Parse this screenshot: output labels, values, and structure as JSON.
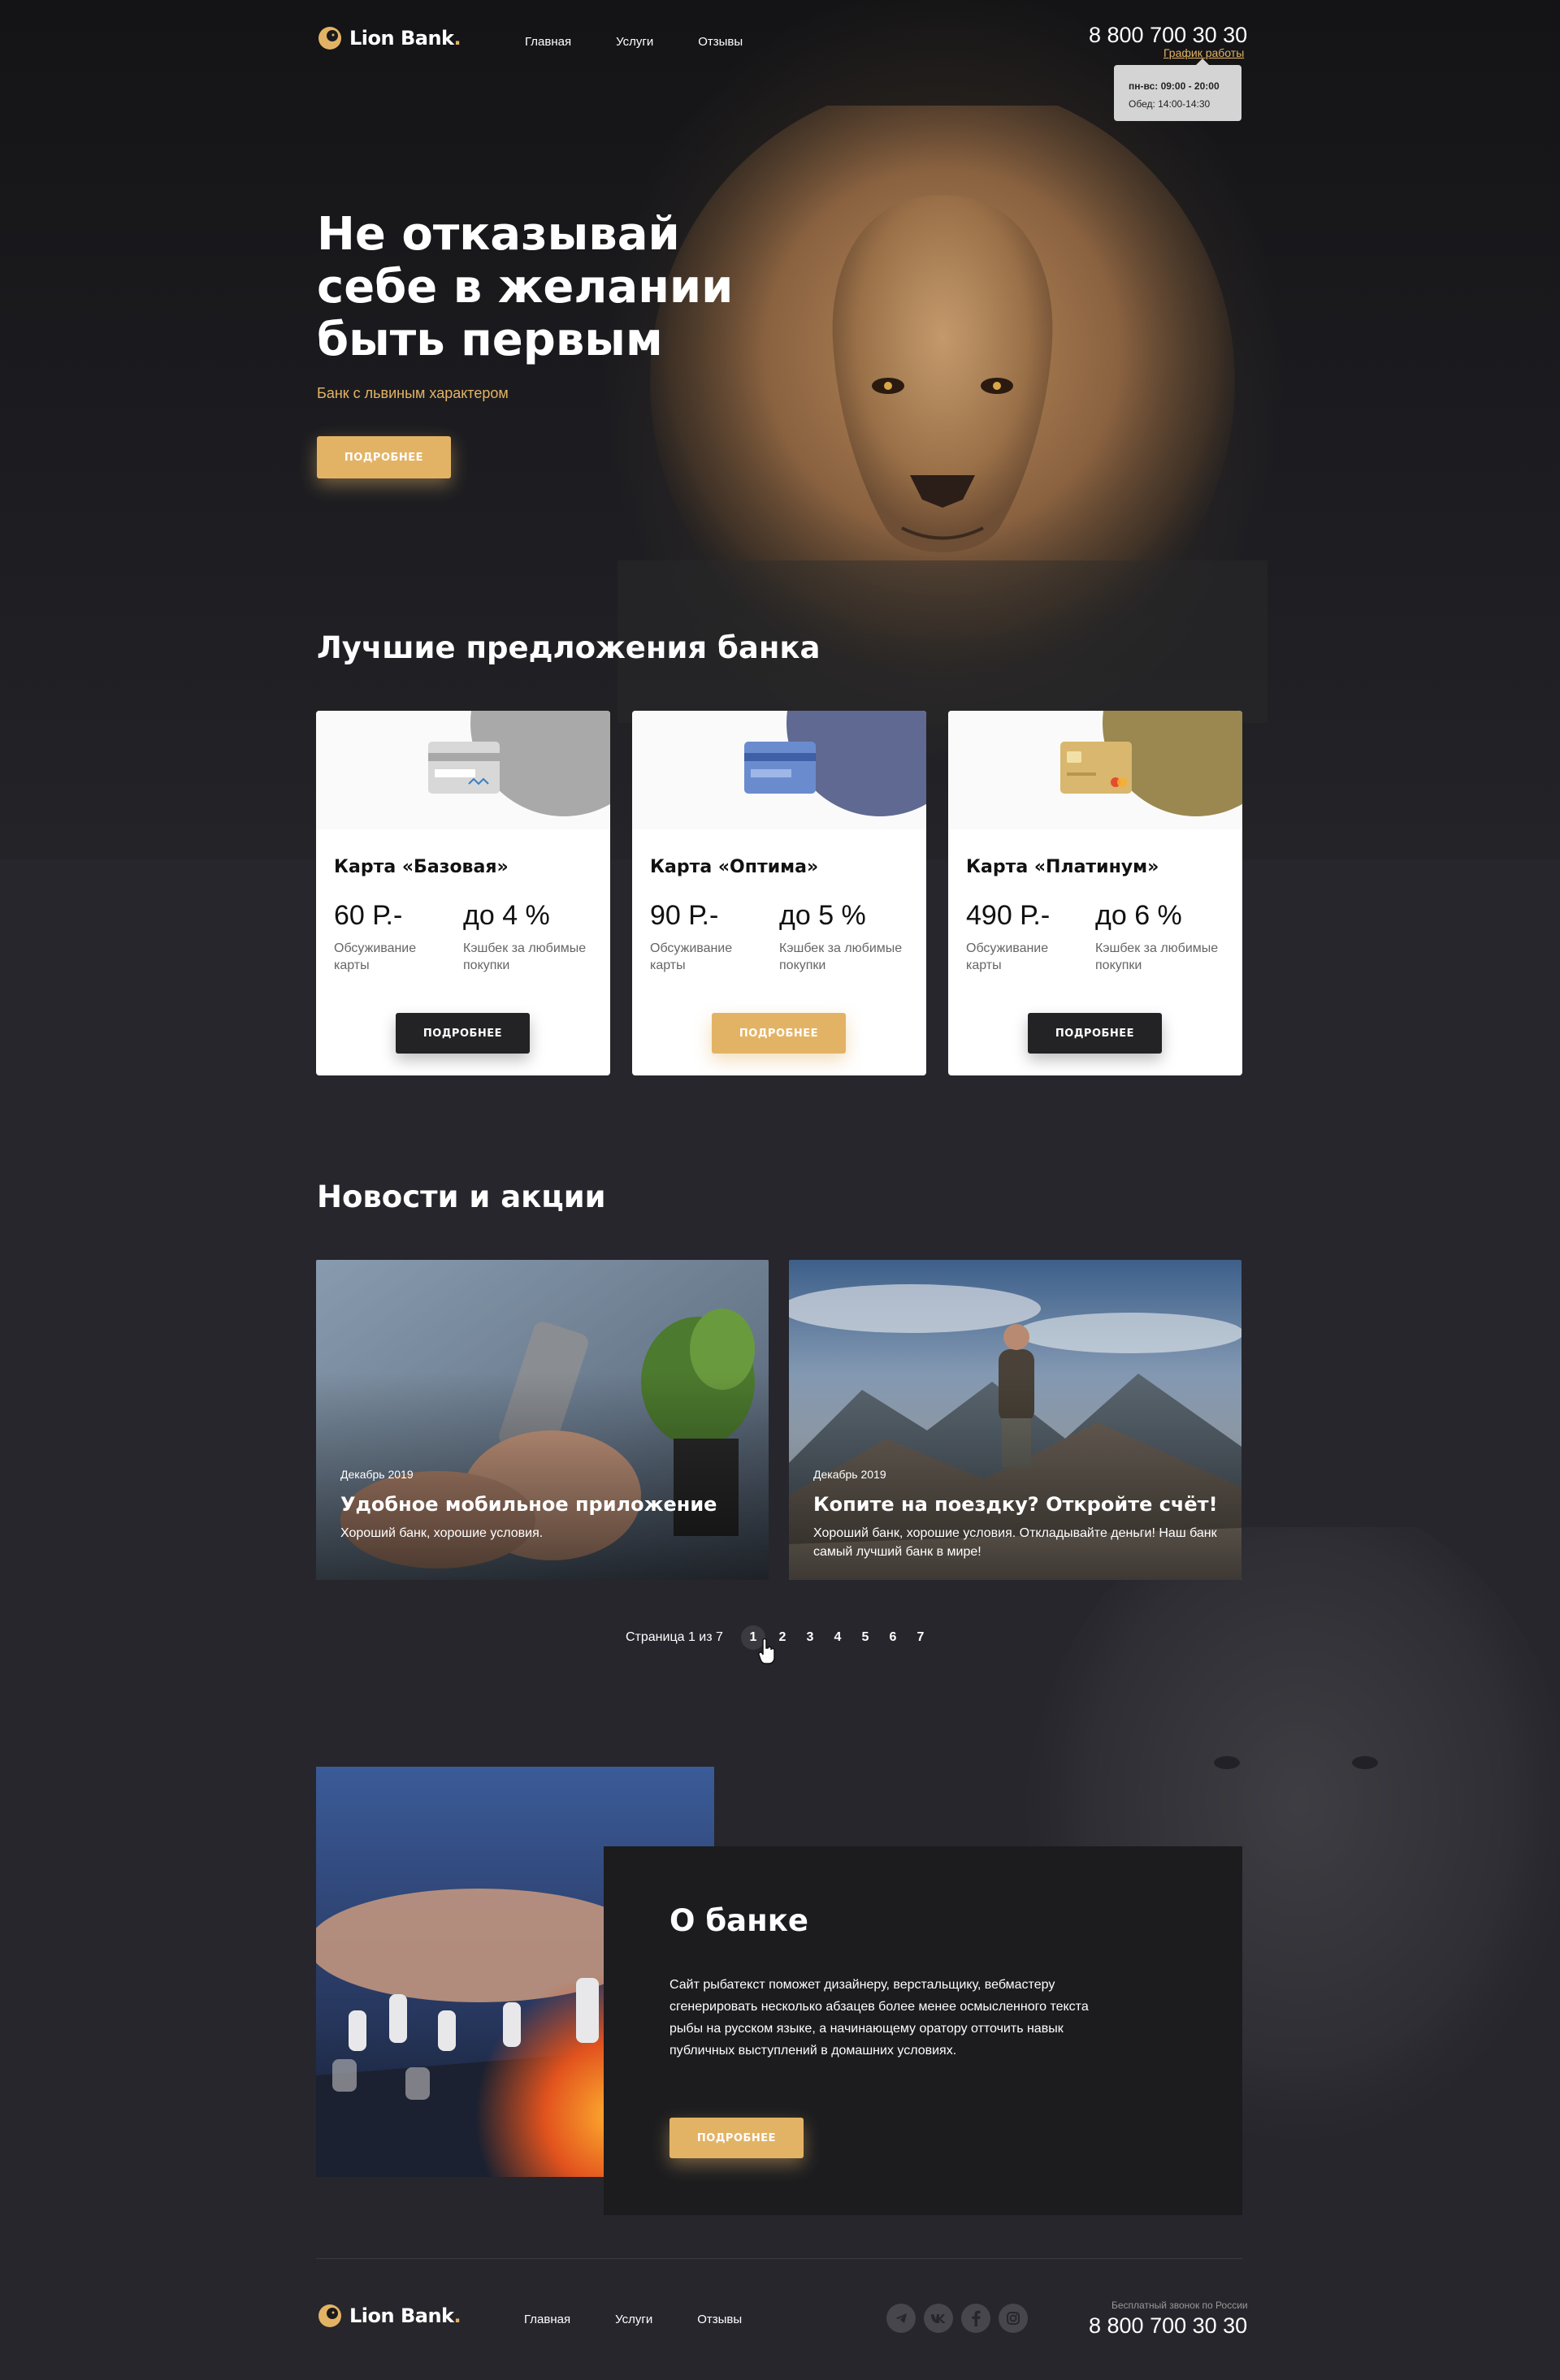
{
  "header": {
    "logo_text": "Lion Bank",
    "logo_dot": ".",
    "nav": [
      "Главная",
      "Услуги",
      "Отзывы"
    ],
    "phone": "8 800 700 30 30",
    "schedule_link": "График работы",
    "schedule_days": "пн-вс: 09:00 - 20:00",
    "schedule_lunch": "Обед: 14:00-14:30"
  },
  "hero": {
    "title_lines": [
      "Не отказывай",
      "себе в желании",
      "быть первым"
    ],
    "subtitle": "Банк с львиным характером",
    "button": "ПОДРОБНЕЕ"
  },
  "offers": {
    "title": "Лучшие предложения банка",
    "cards": [
      {
        "name": "Карта «Базовая»",
        "price": "60 Р.-",
        "price_label": "Обсуживание карты",
        "cashback": "до 4 %",
        "cashback_label": "Кэшбек за любимые покупки",
        "button": "ПОДРОБНЕЕ",
        "accent": "#a9a9a9"
      },
      {
        "name": "Карта «Оптима»",
        "price": "90 Р.-",
        "price_label": "Обсуживание карты",
        "cashback": "до 5 %",
        "cashback_label": "Кэшбек за любимые покупки",
        "button": "ПОДРОБНЕЕ",
        "accent": "#5f6991"
      },
      {
        "name": "Карта «Платинум»",
        "price": "490 Р.-",
        "price_label": "Обсуживание карты",
        "cashback": "до 6 %",
        "cashback_label": "Кэшбек за любимые покупки",
        "button": "ПОДРОБНЕЕ",
        "accent": "#9b8850"
      }
    ]
  },
  "news": {
    "title": "Новости и акции",
    "items": [
      {
        "date": "Декабрь 2019",
        "title": "Удобное мобильное приложение",
        "desc": "Хороший банк, хорошие условия."
      },
      {
        "date": "Декабрь 2019",
        "title": "Копите на поездку? Откройте счёт!",
        "desc": "Хороший банк, хорошие условия. Откладывайте деньги!  Наш банк самый лучший банк в мире!"
      }
    ],
    "pager_label": "Страница 1 из 7",
    "pages": [
      "1",
      "2",
      "3",
      "4",
      "5",
      "6",
      "7"
    ]
  },
  "about": {
    "title": "О банке",
    "text": "Сайт рыбатекст поможет дизайнеру, верстальщику, вебмастеру сгенерировать несколько абзацев более менее осмысленного текста рыбы на русском языке, а начинающему оратору отточить навык публичных выступлений в домашних условиях.",
    "button": "ПОДРОБНЕЕ"
  },
  "footer": {
    "logo_text": "Lion Bank",
    "logo_dot": ".",
    "nav": [
      "Главная",
      "Услуги",
      "Отзывы"
    ],
    "social": [
      "telegram-icon",
      "vk-icon",
      "facebook-icon",
      "instagram-icon"
    ],
    "free_call": "Бесплатный звонок по России",
    "phone": "8 800 700 30 30"
  },
  "colors": {
    "accent": "#e3b365",
    "background": "#26262c",
    "dark_button": "#232325"
  }
}
